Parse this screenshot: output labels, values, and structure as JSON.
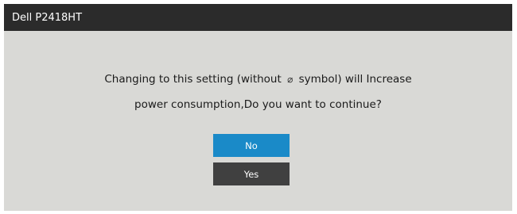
{
  "window": {
    "title": "Dell P2418HT"
  },
  "dialog": {
    "line1_before": "Changing to this setting (without",
    "eco_icon": "leaf-eco-icon",
    "eco_glyph": "⌀",
    "line1_after": "symbol) will Increase",
    "line2": "power consumption,Do you want to continue?"
  },
  "buttons": {
    "no_label": "No",
    "yes_label": "Yes"
  },
  "colors": {
    "titlebar": "#2b2b2b",
    "background": "#d9d9d6",
    "selected_button": "#1a8ac8",
    "button": "#404040"
  }
}
